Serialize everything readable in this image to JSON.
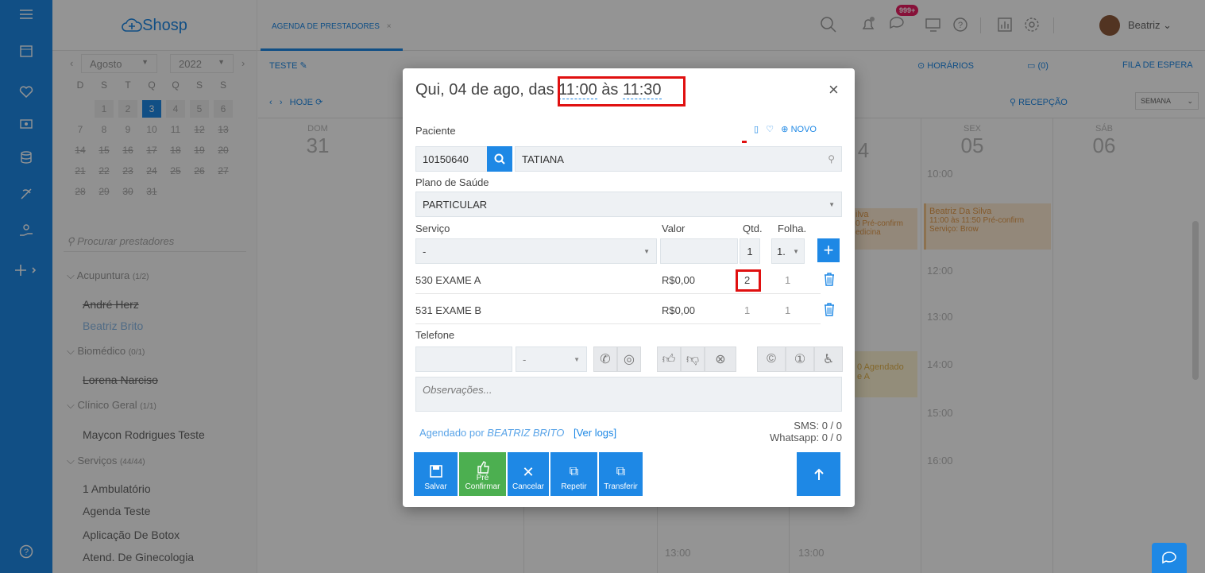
{
  "app": {
    "logo": "Shosp",
    "tab_label": "AGENDA DE PRESTADORES",
    "tab_close": "×",
    "notif_badge": "999+",
    "user_name": "Beatriz",
    "accent": "#1e88e5"
  },
  "sidebar": {
    "month": "Agosto",
    "year": "2022",
    "weekdays": [
      "D",
      "S",
      "T",
      "Q",
      "Q",
      "S",
      "S"
    ],
    "weeks": [
      [
        "",
        "1",
        "2",
        "3",
        "4",
        "5",
        "6"
      ],
      [
        "7",
        "8",
        "9",
        "10",
        "11",
        "12",
        "13"
      ],
      [
        "14",
        "15",
        "16",
        "17",
        "18",
        "19",
        "20"
      ],
      [
        "21",
        "22",
        "23",
        "24",
        "25",
        "26",
        "27"
      ],
      [
        "28",
        "29",
        "30",
        "31",
        "",
        "",
        ""
      ]
    ],
    "search_placeholder": "Procurar prestadores",
    "groups": [
      {
        "label": "Acupuntura",
        "count": "(1/2)",
        "items": [
          "André Herz",
          "Beatriz Brito"
        ]
      },
      {
        "label": "Biomédico",
        "count": "(0/1)",
        "items": [
          "Lorena Narciso"
        ]
      },
      {
        "label": "Clínico Geral",
        "count": "(1/1)",
        "items": [
          "Maycon Rodrigues Teste"
        ]
      },
      {
        "label": "Serviços",
        "count": "(44/44)",
        "items": [
          "1 Ambulatório",
          "Agenda Teste",
          "Aplicação De Botox",
          "Atend. De Ginecologia"
        ]
      }
    ]
  },
  "calendar": {
    "title": "TESTE",
    "today": "HOJE",
    "horarios": "HORÁRIOS",
    "messages": "(0)",
    "fila": "FILA DE ESPERA",
    "recepcao": "RECEPÇÃO",
    "view": "SEMANA",
    "days": [
      {
        "name": "DOM",
        "num": "31"
      },
      {
        "name": "SEX",
        "num": "05"
      },
      {
        "name": "SÁB",
        "num": "06"
      }
    ],
    "partial_day_num": "4",
    "hours": [
      "10:00",
      "12:00",
      "13:00",
      "14:00",
      "15:00",
      "16:00",
      "13:00",
      "13:00"
    ],
    "events": [
      {
        "title": "Beatriz Da Silva",
        "time": "11:00 às 11:50 Pré-confirm",
        "extra": "Serviço: Brow"
      },
      {
        "partial_title": "ilva",
        "partial_time": "0 Pré-confirm",
        "partial_extra": "edicina"
      },
      {
        "partial_title": "0 Agendado",
        "partial_extra": "e A"
      }
    ]
  },
  "modal": {
    "title_prefix": "Qui, 04 de ago, das ",
    "time_start": "11:00",
    "time_sep": " às ",
    "time_end": "11:30",
    "paciente_label": "Paciente",
    "novo": "NOVO",
    "patient_id": "10150640",
    "patient_name": "TATIANA",
    "plano_label": "Plano de Saúde",
    "plano_value": "PARTICULAR",
    "servico_label": "Serviço",
    "valor_label": "Valor",
    "qtd_label": "Qtd.",
    "folha_label": "Folha.",
    "servico_select": "-",
    "qtd_input": "1",
    "folha_select": "1.",
    "services": [
      {
        "name": "530 EXAME A",
        "price": "R$0,00",
        "qty": "2",
        "folha": "1"
      },
      {
        "name": "531 EXAME B",
        "price": "R$0,00",
        "qty": "1",
        "folha": "1"
      }
    ],
    "telefone_label": "Telefone",
    "tel_type": "-",
    "obs_placeholder": "Observações...",
    "agendado_prefix": "Agendado por ",
    "agendado_by": "BEATRIZ BRITO",
    "ver_logs": "[Ver logs]",
    "sms": "SMS: 0 / 0",
    "whatsapp": "Whatsapp: 0 / 0",
    "buttons": {
      "salvar": "Salvar",
      "pre": "Pré",
      "confirmar": "Confirmar",
      "cancelar": "Cancelar",
      "repetir": "Repetir",
      "transferir": "Transferir"
    }
  }
}
